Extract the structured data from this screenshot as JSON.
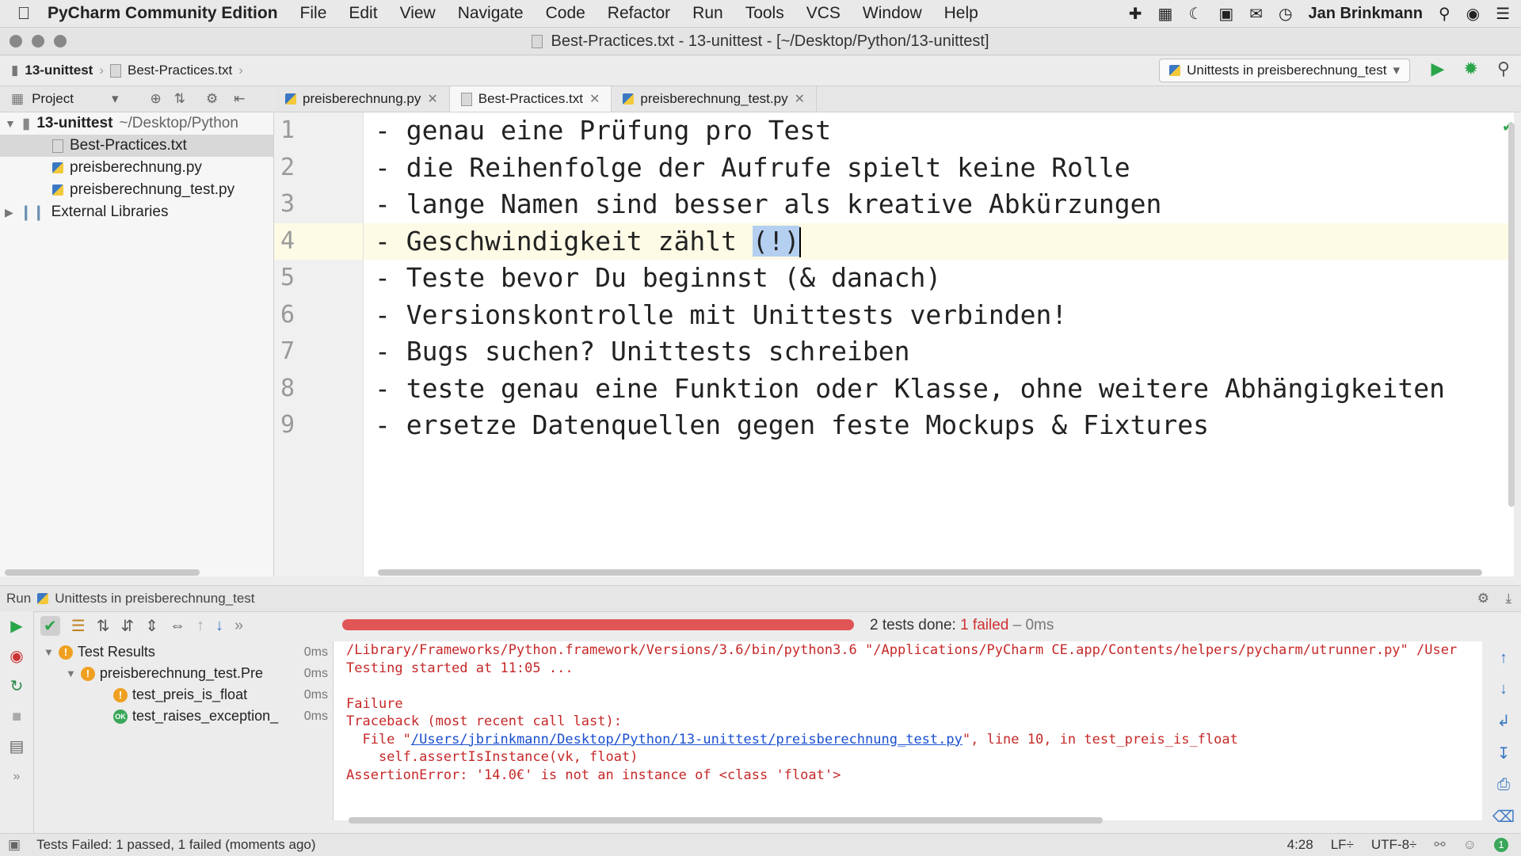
{
  "menubar": {
    "app": "PyCharm Community Edition",
    "items": [
      "File",
      "Edit",
      "View",
      "Navigate",
      "Code",
      "Refactor",
      "Run",
      "Tools",
      "VCS",
      "Window",
      "Help"
    ],
    "user": "Jan Brinkmann"
  },
  "window": {
    "title": "Best-Practices.txt - 13-unittest - [~/Desktop/Python/13-unittest]"
  },
  "breadcrumb": {
    "project": "13-unittest",
    "file": "Best-Practices.txt"
  },
  "run_config": {
    "label": "Unittests in preisberechnung_test"
  },
  "project_panel": {
    "title": "Project",
    "root": "13-unittest",
    "root_path": "~/Desktop/Python",
    "files": [
      "Best-Practices.txt",
      "preisberechnung.py",
      "preisberechnung_test.py"
    ],
    "external": "External Libraries"
  },
  "tabs": [
    {
      "label": "preisberechnung.py"
    },
    {
      "label": "Best-Practices.txt"
    },
    {
      "label": "preisberechnung_test.py"
    }
  ],
  "editor": {
    "line_numbers": [
      "1",
      "2",
      "3",
      "4",
      "5",
      "6",
      "7",
      "8",
      "9"
    ],
    "lines": [
      "- genau eine Prüfung pro Test",
      "- die Reihenfolge der Aufrufe spielt keine Rolle",
      "- lange Namen sind besser als kreative Abkürzungen",
      "- Geschwindigkeit zählt ",
      "- Teste bevor Du beginnst (& danach)",
      "- Versionskontrolle mit Unittests verbinden!",
      "- Bugs suchen? Unittests schreiben",
      "- teste genau eine Funktion oder Klasse, ohne weitere Abhängigkeiten",
      "- ersetze Datenquellen gegen feste Mockups & Fixtures"
    ],
    "selected_text": "(!)"
  },
  "run_panel": {
    "label": "Run",
    "config": "Unittests in preisberechnung_test",
    "summary_prefix": "2 tests done: ",
    "summary_failed": "1 failed",
    "summary_suffix": " – 0ms",
    "progress_fraction": 1.0,
    "tree": {
      "root": "Test Results",
      "root_dur": "0ms",
      "suite": "preisberechnung_test.Pre",
      "suite_dur": "0ms",
      "tests": [
        {
          "name": "test_preis_is_float",
          "dur": "0ms",
          "status": "failed"
        },
        {
          "name": "test_raises_exception_",
          "dur": "0ms",
          "status": "passed"
        }
      ]
    },
    "console": {
      "cmd": "/Library/Frameworks/Python.framework/Versions/3.6/bin/python3.6 \"/Applications/PyCharm CE.app/Contents/helpers/pycharm/utrunner.py\" /User",
      "started": "Testing started at 11:05 ...",
      "failure": "Failure",
      "traceback": "Traceback (most recent call last):",
      "file_prefix": "  File \"",
      "file_link": "/Users/jbrinkmann/Desktop/Python/13-unittest/preisberechnung_test.py",
      "file_suffix": "\", line 10, in test_preis_is_float",
      "code": "    self.assertIsInstance(vk, float)",
      "error": "AssertionError: '14.0€' is not an instance of <class 'float'>"
    }
  },
  "statusbar": {
    "message": "Tests Failed: 1 passed, 1 failed (moments ago)",
    "position": "4:28",
    "line_sep": "LF÷",
    "encoding": "UTF-8÷"
  }
}
